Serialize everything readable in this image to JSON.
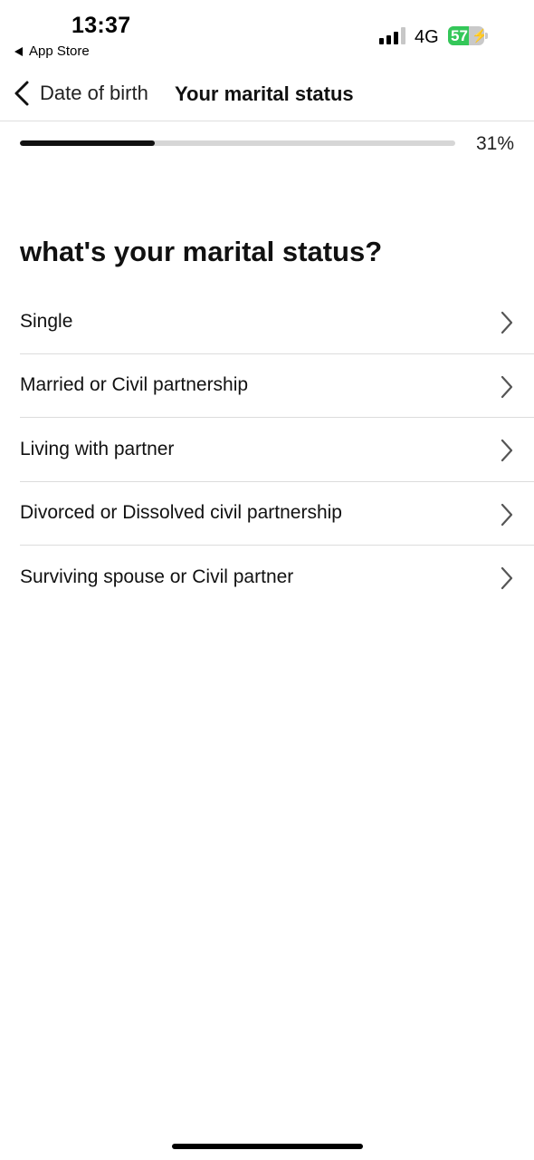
{
  "status_bar": {
    "time": "13:37",
    "back_app": "App Store",
    "network": "4G",
    "battery_level": "57",
    "battery_fraction": 0.57,
    "battery_color": "#34c759"
  },
  "nav": {
    "back_label": "Date of birth",
    "title": "Your marital status"
  },
  "progress": {
    "value": 0.31,
    "label": "31%"
  },
  "question": "what's your marital status?",
  "options": [
    {
      "label": "Single"
    },
    {
      "label": "Married or Civil partnership"
    },
    {
      "label": "Living with partner"
    },
    {
      "label": "Divorced or Dissolved civil partnership"
    },
    {
      "label": "Surviving spouse or Civil partner"
    }
  ],
  "icons": {
    "back": "chevron-left-icon",
    "option": "chevron-right-icon"
  }
}
